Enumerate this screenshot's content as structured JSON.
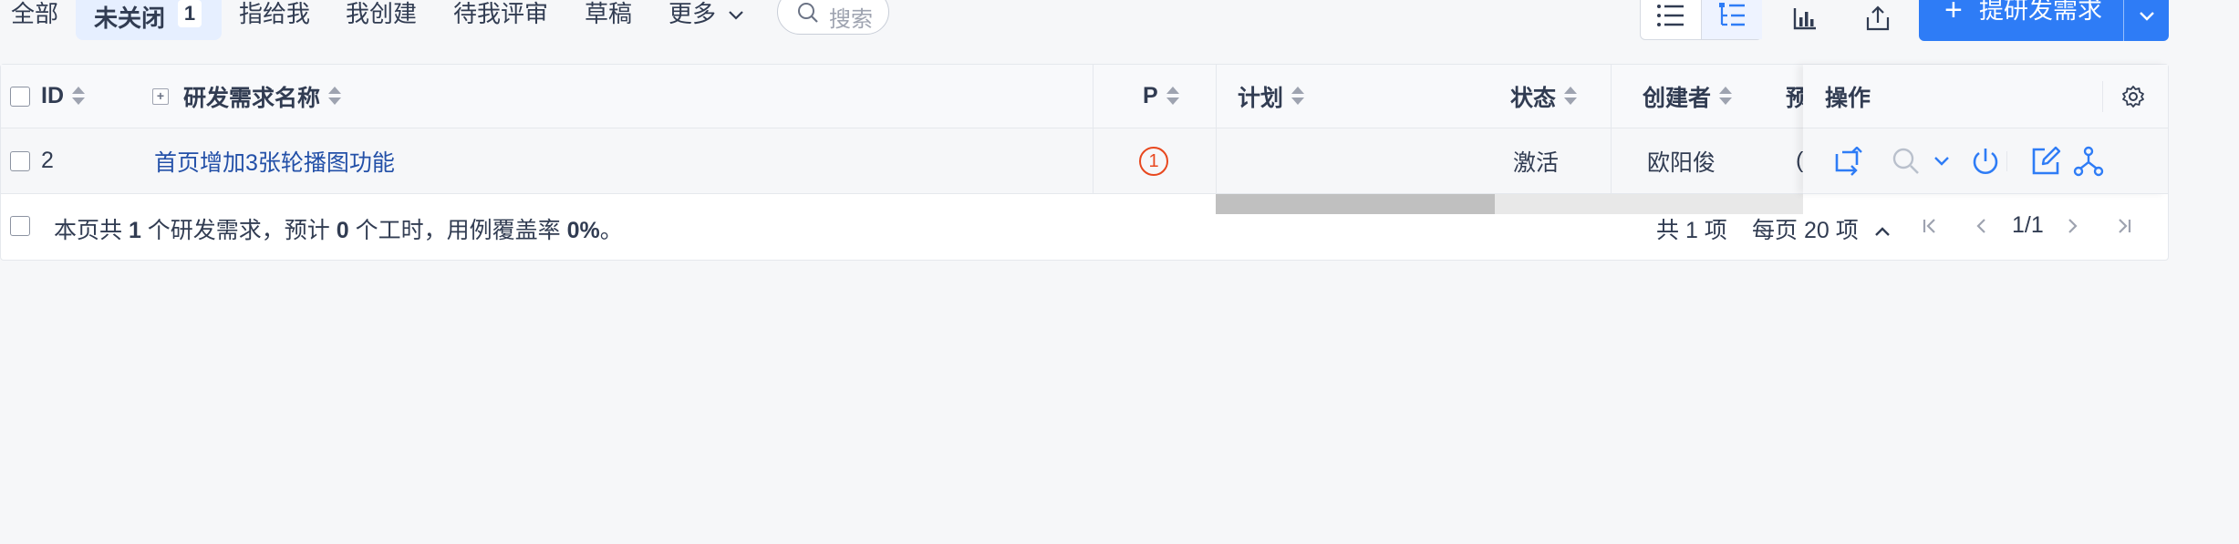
{
  "tabs": [
    {
      "label": "全部"
    },
    {
      "label": "未关闭",
      "badge": "1",
      "active": true
    },
    {
      "label": "指给我"
    },
    {
      "label": "我创建"
    },
    {
      "label": "待我评审"
    },
    {
      "label": "草稿"
    },
    {
      "label": "更多"
    }
  ],
  "search": {
    "placeholder": "搜索"
  },
  "toolbar": {
    "primary_label": "提研发需求",
    "icons": [
      "list-view-icon",
      "tree-view-icon",
      "bar-chart-icon",
      "export-icon"
    ]
  },
  "table": {
    "headers": {
      "id": "ID",
      "name": "研发需求名称",
      "pri": "P",
      "plan": "计划",
      "status": "状态",
      "creator": "创建者",
      "truncated": "预",
      "actions": "操作"
    },
    "rows": [
      {
        "id": "2",
        "name": "首页增加3张轮播图功能",
        "pri": "1",
        "plan": "",
        "status": "激活",
        "creator": "欧阳俊",
        "truncated": "("
      }
    ]
  },
  "footer": {
    "prefix": "本页共 ",
    "count": "1",
    "mid1": " 个研发需求，预计 ",
    "hours": "0",
    "mid2": " 个工时，用例覆盖率 ",
    "coverage": "0%",
    "suffix": "。",
    "total": "共 1 项",
    "per_page": "每页 20 项",
    "page": "1/1"
  },
  "colors": {
    "primary": "#2e7cf6",
    "priority": "#e8481f",
    "link": "#2350a8"
  }
}
